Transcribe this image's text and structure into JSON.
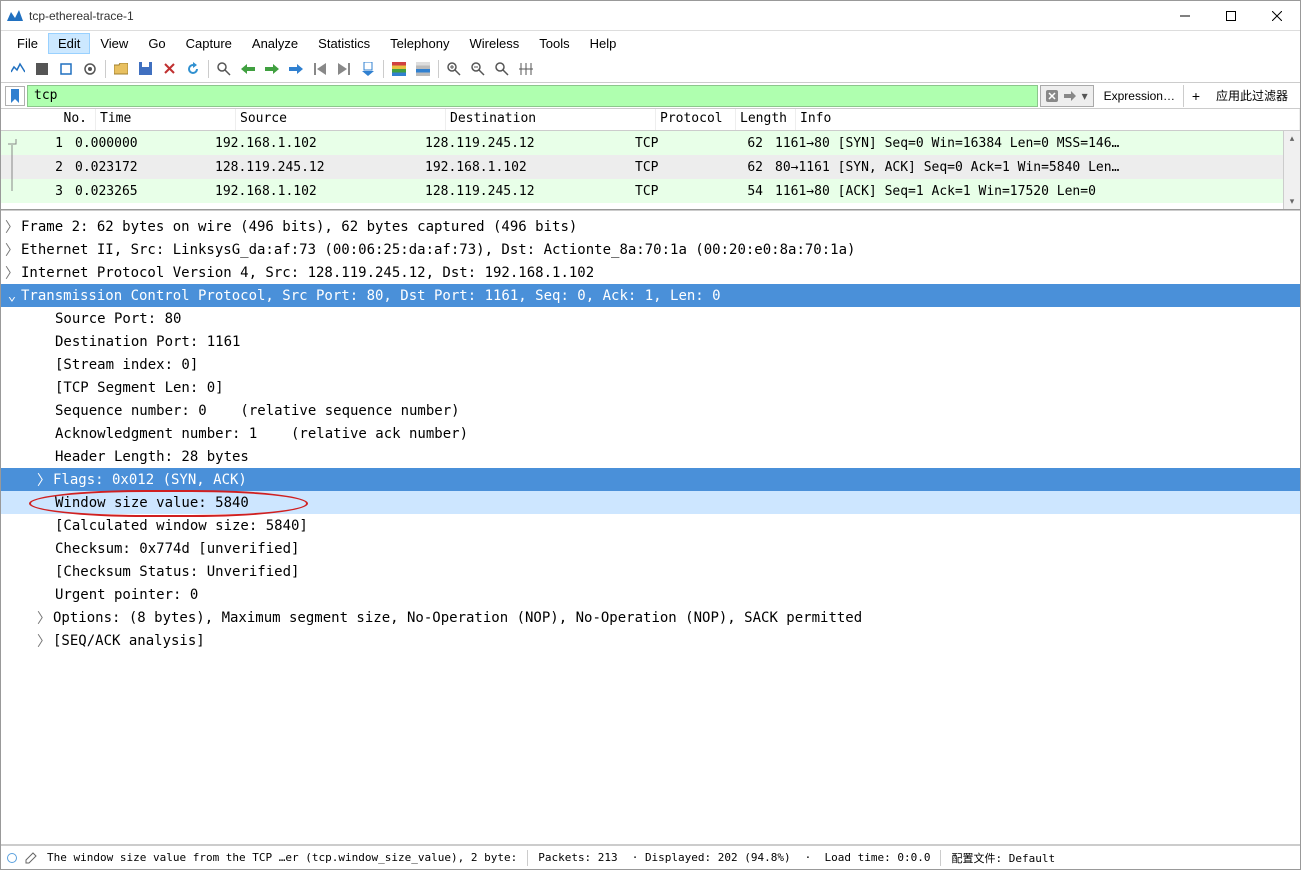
{
  "window": {
    "title": "tcp-ethereal-trace-1"
  },
  "menu": [
    "File",
    "Edit",
    "View",
    "Go",
    "Capture",
    "Analyze",
    "Statistics",
    "Telephony",
    "Wireless",
    "Tools",
    "Help"
  ],
  "menu_highlight_index": 1,
  "filter": {
    "value": "tcp",
    "expression_label": "Expression…",
    "apply_label": "应用此过滤器"
  },
  "columns": {
    "no": "No.",
    "time": "Time",
    "source": "Source",
    "destination": "Destination",
    "protocol": "Protocol",
    "length": "Length",
    "info": "Info"
  },
  "packets": [
    {
      "no": "1",
      "time": "0.000000",
      "src": "192.168.1.102",
      "dst": "128.119.245.12",
      "proto": "TCP",
      "len": "62",
      "info": "1161→80 [SYN] Seq=0 Win=16384 Len=0 MSS=146…"
    },
    {
      "no": "2",
      "time": "0.023172",
      "src": "128.119.245.12",
      "dst": "192.168.1.102",
      "proto": "TCP",
      "len": "62",
      "info": "80→1161 [SYN, ACK] Seq=0 Ack=1 Win=5840 Len…"
    },
    {
      "no": "3",
      "time": "0.023265",
      "src": "192.168.1.102",
      "dst": "128.119.245.12",
      "proto": "TCP",
      "len": "54",
      "info": "1161→80 [ACK] Seq=1 Ack=1 Win=17520 Len=0"
    }
  ],
  "details": {
    "frame": "Frame 2: 62 bytes on wire (496 bits), 62 bytes captured (496 bits)",
    "eth": "Ethernet II, Src: LinksysG_da:af:73 (00:06:25:da:af:73), Dst: Actionte_8a:70:1a (00:20:e0:8a:70:1a)",
    "ip": "Internet Protocol Version 4, Src: 128.119.245.12, Dst: 192.168.1.102",
    "tcp": "Transmission Control Protocol, Src Port: 80, Dst Port: 1161, Seq: 0, Ack: 1, Len: 0",
    "srcport": "Source Port: 80",
    "dstport": "Destination Port: 1161",
    "stream": "[Stream index: 0]",
    "seglen": "[TCP Segment Len: 0]",
    "seqnum": "Sequence number: 0    (relative sequence number)",
    "acknum": "Acknowledgment number: 1    (relative ack number)",
    "hdrlen": "Header Length: 28 bytes",
    "flags": "Flags: 0x012 (SYN, ACK)",
    "winsize": "Window size value: 5840",
    "calcwin": "[Calculated window size: 5840]",
    "cksum": "Checksum: 0x774d [unverified]",
    "ckstat": "[Checksum Status: Unverified]",
    "urgptr": "Urgent pointer: 0",
    "options": "Options: (8 bytes), Maximum segment size, No-Operation (NOP), No-Operation (NOP), SACK permitted",
    "seqack": "[SEQ/ACK analysis]"
  },
  "status": {
    "field": "The window size value from the TCP …er (tcp.window_size_value), 2 byte:",
    "packets": "Packets: 213",
    "displayed": "Displayed: 202 (94.8%)",
    "loadtime": "Load time: 0:0.0",
    "profile": "配置文件: Default"
  }
}
